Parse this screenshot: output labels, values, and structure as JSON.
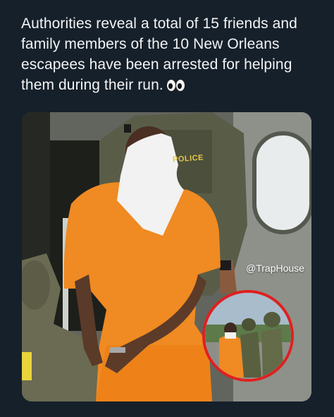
{
  "post": {
    "text": "Authorities reveal a total of 15 friends and family members of the 10 New Orleans escapees have been arrested for helping them during their run.",
    "emoji_icon": "eyes-icon"
  },
  "media": {
    "watermark": "@TrapHouse",
    "vest_label": "POLICE",
    "colors": {
      "background": "#16202a",
      "jumpsuit": "#f08a22",
      "inset_border": "#e01f1f"
    }
  }
}
